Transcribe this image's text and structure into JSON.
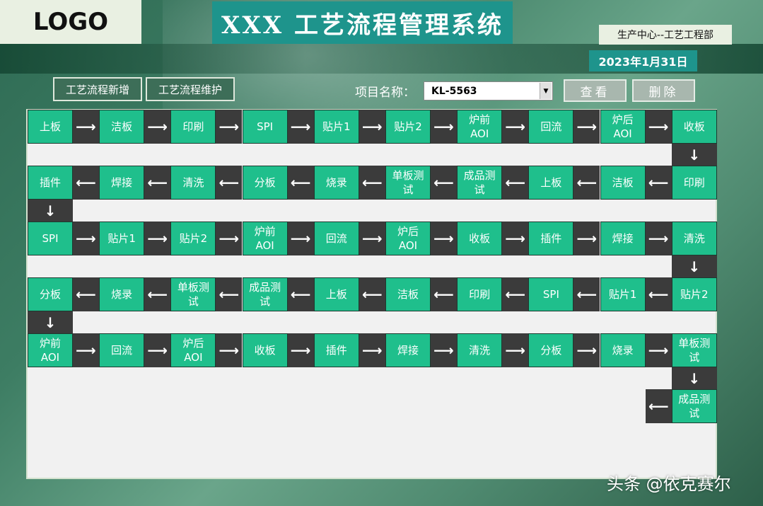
{
  "header": {
    "logo": "LOGO",
    "title": "XXX 工艺流程管理系统",
    "department": "生产中心--工艺工程部",
    "date": "2023年1月31日"
  },
  "toolbar": {
    "add_label": "工艺流程新增",
    "maintain_label": "工艺流程维护",
    "project_label": "项目名称：",
    "project_value": "KL-5563",
    "query_label": "查看",
    "delete_label": "删除"
  },
  "flow": {
    "rows": [
      {
        "direction": "right",
        "steps": [
          "上板",
          "洁板",
          "印刷",
          "SPI",
          "贴片1",
          "贴片2",
          "炉前\nAOI",
          "回流",
          "炉后\nAOI",
          "收板"
        ]
      },
      {
        "direction": "left",
        "steps": [
          "印刷",
          "洁板",
          "上板",
          "成品测\n试",
          "单板测\n试",
          "烧录",
          "分板",
          "清洗",
          "焊接",
          "插件"
        ]
      },
      {
        "direction": "right",
        "steps": [
          "SPI",
          "贴片1",
          "贴片2",
          "炉前\nAOI",
          "回流",
          "炉后\nAOI",
          "收板",
          "插件",
          "焊接",
          "清洗"
        ]
      },
      {
        "direction": "left",
        "steps": [
          "贴片2",
          "贴片1",
          "SPI",
          "印刷",
          "洁板",
          "上板",
          "成品测\n试",
          "单板测\n试",
          "烧录",
          "分板"
        ]
      },
      {
        "direction": "right",
        "steps": [
          "炉前\nAOI",
          "回流",
          "炉后\nAOI",
          "收板",
          "插件",
          "焊接",
          "清洗",
          "分板",
          "烧录",
          "单板测\n试"
        ]
      },
      {
        "direction": "left",
        "steps": [
          "成品测\n试"
        ]
      }
    ],
    "arrows": {
      "right": "⟶",
      "left": "⟵",
      "down": "↓"
    }
  },
  "watermark": "头条 @依克赛尔",
  "colors": {
    "step_fill": "#1fbf8c",
    "arrow_fill": "#3b3b3b",
    "title_fill": "#1e948c"
  }
}
